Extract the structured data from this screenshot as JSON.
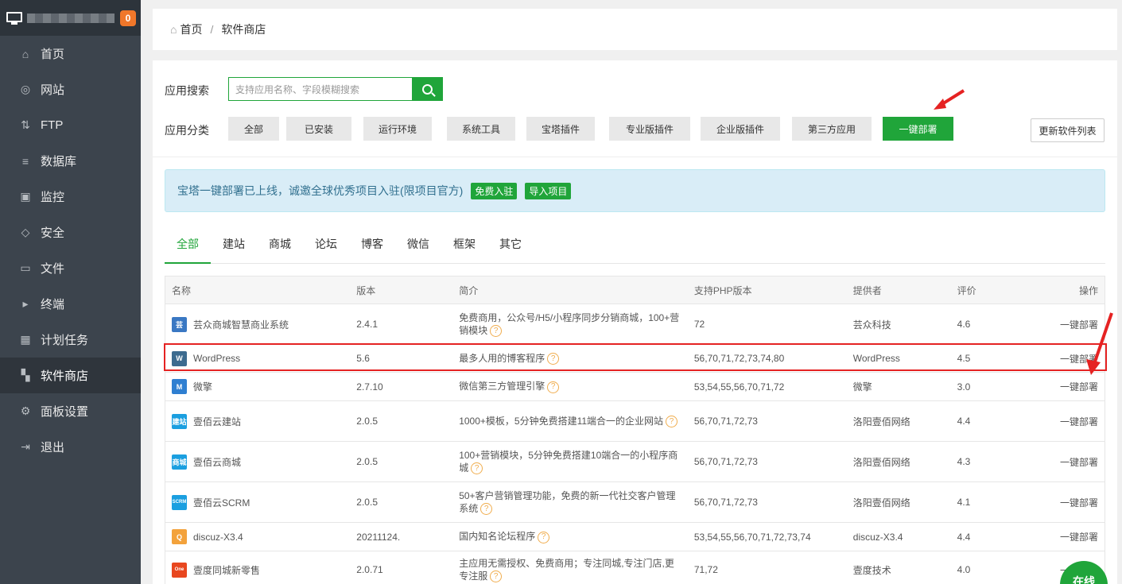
{
  "sidebar": {
    "badge": "0",
    "items": [
      {
        "label": "首页",
        "icon": "home-icon",
        "glyph": "⌂"
      },
      {
        "label": "网站",
        "icon": "globe-icon",
        "glyph": "◎"
      },
      {
        "label": "FTP",
        "icon": "ftp-icon",
        "glyph": "⇅"
      },
      {
        "label": "数据库",
        "icon": "database-icon",
        "glyph": "≡"
      },
      {
        "label": "监控",
        "icon": "monitor-icon",
        "glyph": "▣"
      },
      {
        "label": "安全",
        "icon": "shield-icon",
        "glyph": "◇"
      },
      {
        "label": "文件",
        "icon": "folder-icon",
        "glyph": "▭"
      },
      {
        "label": "终端",
        "icon": "terminal-icon",
        "glyph": "▸"
      },
      {
        "label": "计划任务",
        "icon": "calendar-icon",
        "glyph": "▦"
      },
      {
        "label": "软件商店",
        "icon": "grid-icon",
        "glyph": "▚"
      },
      {
        "label": "面板设置",
        "icon": "gear-icon",
        "glyph": "⚙"
      },
      {
        "label": "退出",
        "icon": "logout-icon",
        "glyph": "⇥"
      }
    ]
  },
  "breadcrumb": {
    "home": "首页",
    "current": "软件商店"
  },
  "search": {
    "label": "应用搜索",
    "placeholder": "支持应用名称、字段模糊搜索"
  },
  "category": {
    "label": "应用分类",
    "buttons": [
      "全部",
      "已安装",
      "运行环境",
      "系统工具",
      "宝塔插件",
      "专业版插件",
      "企业版插件",
      "第三方应用",
      "一键部署"
    ],
    "update_label": "更新软件列表"
  },
  "notice": {
    "text": "宝塔一键部署已上线，诚邀全球优秀项目入驻(限项目官方)",
    "btn1": "免费入驻",
    "btn2": "导入项目"
  },
  "tabs": [
    "全部",
    "建站",
    "商城",
    "论坛",
    "博客",
    "微信",
    "框架",
    "其它"
  ],
  "table": {
    "headers": [
      "名称",
      "版本",
      "简介",
      "支持PHP版本",
      "提供者",
      "评价",
      "操作"
    ],
    "rows": [
      {
        "name": "芸众商城智慧商业系统",
        "version": "2.4.1",
        "desc": "免费商用，公众号/H5/小程序同步分销商城，100+营销模块",
        "php": "72",
        "provider": "芸众科技",
        "rating": "4.6",
        "action": "一键部署",
        "logo_color": "#3a78c3",
        "logo_text": "芸"
      },
      {
        "name": "WordPress",
        "version": "5.6",
        "desc": "最多人用的博客程序",
        "php": "56,70,71,72,73,74,80",
        "provider": "WordPress",
        "rating": "4.5",
        "action": "一键部署",
        "logo_color": "#3c6b8f",
        "logo_text": "W"
      },
      {
        "name": "微擎",
        "version": "2.7.10",
        "desc": "微信第三方管理引擎",
        "php": "53,54,55,56,70,71,72",
        "provider": "微擎",
        "rating": "3.0",
        "action": "一键部署",
        "logo_color": "#2f7fd1",
        "logo_text": "M"
      },
      {
        "name": "壹佰云建站",
        "version": "2.0.5",
        "desc": "1000+模板，5分钟免费搭建11端合一的企业网站",
        "php": "56,70,71,72,73",
        "provider": "洛阳壹佰网络",
        "rating": "4.4",
        "action": "一键部署",
        "logo_color": "#1b9fe0",
        "logo_text": "建站"
      },
      {
        "name": "壹佰云商城",
        "version": "2.0.5",
        "desc": "100+营销模块，5分钟免费搭建10端合一的小程序商城",
        "php": "56,70,71,72,73",
        "provider": "洛阳壹佰网络",
        "rating": "4.3",
        "action": "一键部署",
        "logo_color": "#1b9fe0",
        "logo_text": "商城"
      },
      {
        "name": "壹佰云SCRM",
        "version": "2.0.5",
        "desc": "50+客户营销管理功能，免费的新一代社交客户管理系统",
        "php": "56,70,71,72,73",
        "provider": "洛阳壹佰网络",
        "rating": "4.1",
        "action": "一键部署",
        "logo_color": "#1b9fe0",
        "logo_text": "SCRM"
      },
      {
        "name": "discuz-X3.4",
        "version": "20211124.",
        "desc": "国内知名论坛程序",
        "php": "53,54,55,56,70,71,72,73,74",
        "provider": "discuz-X3.4",
        "rating": "4.4",
        "action": "一键部署",
        "logo_color": "#f3a23b",
        "logo_text": "Q"
      },
      {
        "name": "壹度同城新零售",
        "version": "2.0.71",
        "desc": "主应用无需授权、免费商用；专注同城,专注门店,更专注服",
        "php": "71,72",
        "provider": "壹度技术",
        "rating": "4.0",
        "action": "一键部署",
        "logo_color": "#e8471f",
        "logo_text": "One"
      }
    ]
  },
  "online_label": "在线"
}
